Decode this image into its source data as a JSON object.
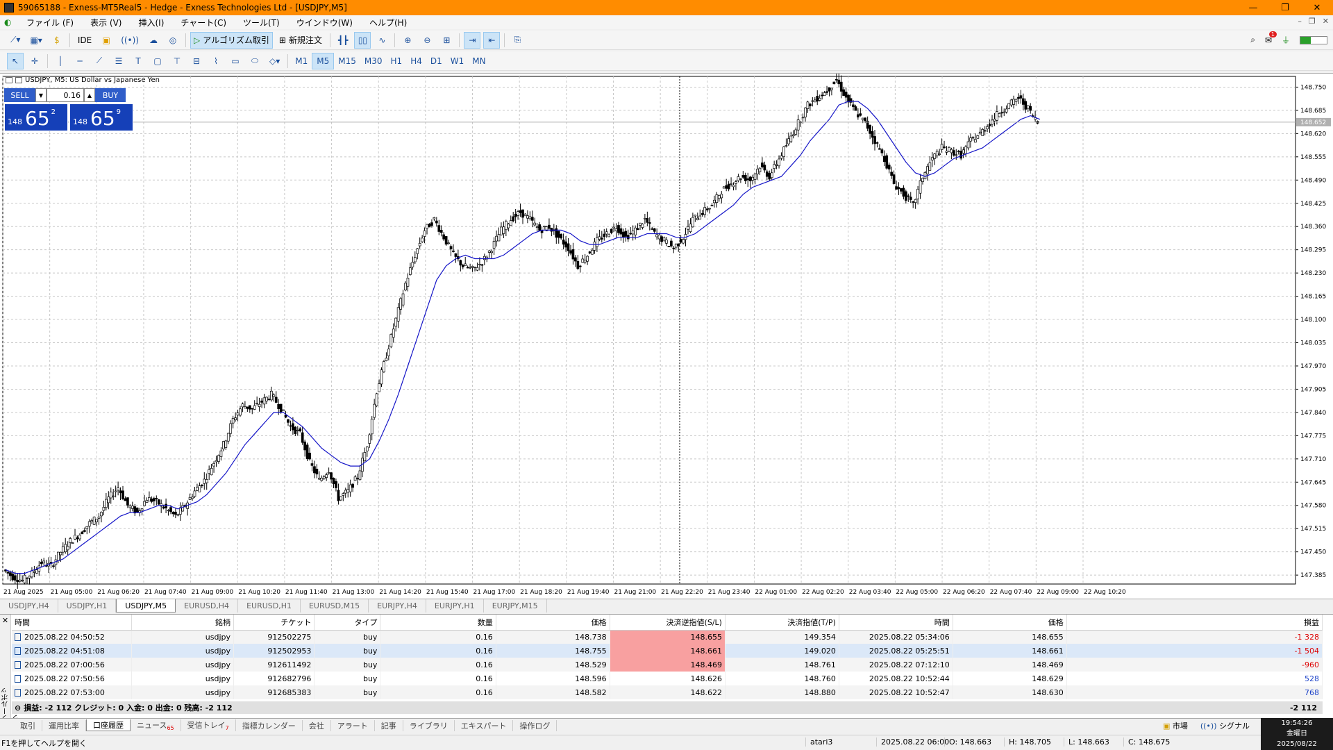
{
  "window": {
    "title": "59065188 - Exness-MT5Real5 - Hedge - Exness Technologies Ltd - [USDJPY,M5]"
  },
  "menu": [
    "ファイル (F)",
    "表示 (V)",
    "挿入(I)",
    "チャート(C)",
    "ツール(T)",
    "ウインドウ(W)",
    "ヘルプ(H)"
  ],
  "toolbar": {
    "ide": "IDE",
    "algo": "アルゴリズム取引",
    "new_order": "新規注文",
    "notif_count": "1"
  },
  "timeframes": [
    "M1",
    "M5",
    "M15",
    "M30",
    "H1",
    "H4",
    "D1",
    "W1",
    "MN"
  ],
  "active_timeframe": "M5",
  "chart": {
    "label": "USDJPY, M5:  US Dollar vs Japanese Yen",
    "sell_label": "SELL",
    "buy_label": "BUY",
    "volume": "0.16",
    "sell_prefix": "148",
    "sell_big": "65",
    "sell_sup": "2",
    "buy_prefix": "148",
    "buy_big": "65",
    "buy_sup": "9",
    "current_price": "148.652"
  },
  "chart_data": {
    "type": "candlestick",
    "symbol": "USDJPY",
    "timeframe": "M5",
    "y_ticks": [
      "148.750",
      "148.685",
      "148.620",
      "148.555",
      "148.490",
      "148.425",
      "148.360",
      "148.295",
      "148.230",
      "148.165",
      "148.100",
      "148.035",
      "147.970",
      "147.905",
      "147.840",
      "147.775",
      "147.710",
      "147.645",
      "147.580",
      "147.515",
      "147.450",
      "147.385"
    ],
    "x_ticks": [
      "21 Aug 2025",
      "21 Aug 05:00",
      "21 Aug 06:20",
      "21 Aug 07:40",
      "21 Aug 09:00",
      "21 Aug 10:20",
      "21 Aug 11:40",
      "21 Aug 13:00",
      "21 Aug 14:20",
      "21 Aug 15:40",
      "21 Aug 17:00",
      "21 Aug 18:20",
      "21 Aug 19:40",
      "21 Aug 21:00",
      "21 Aug 22:20",
      "21 Aug 23:40",
      "22 Aug 01:00",
      "22 Aug 02:20",
      "22 Aug 03:40",
      "22 Aug 05:00",
      "22 Aug 06:20",
      "22 Aug 07:40",
      "22 Aug 09:00",
      "22 Aug 10:20"
    ],
    "ylim": [
      147.36,
      148.78
    ],
    "close_path": [
      147.4,
      147.38,
      147.37,
      147.39,
      147.42,
      147.41,
      147.45,
      147.48,
      147.5,
      147.53,
      147.55,
      147.6,
      147.63,
      147.58,
      147.56,
      147.6,
      147.59,
      147.57,
      147.55,
      147.58,
      147.62,
      147.65,
      147.7,
      147.75,
      147.82,
      147.86,
      147.85,
      147.87,
      147.89,
      147.85,
      147.8,
      147.78,
      147.7,
      147.65,
      147.68,
      147.6,
      147.62,
      147.66,
      147.75,
      147.9,
      148.0,
      148.1,
      148.2,
      148.28,
      148.35,
      148.38,
      148.33,
      148.28,
      148.25,
      148.24,
      148.26,
      148.3,
      148.35,
      148.38,
      148.4,
      148.38,
      148.35,
      148.36,
      148.33,
      148.3,
      148.25,
      148.28,
      148.32,
      148.34,
      148.36,
      148.33,
      148.35,
      148.38,
      148.34,
      148.32,
      148.3,
      148.33,
      148.38,
      148.4,
      148.42,
      148.46,
      148.48,
      148.5,
      148.49,
      148.53,
      148.5,
      148.55,
      148.6,
      148.65,
      148.7,
      148.72,
      148.74,
      148.77,
      148.72,
      148.68,
      148.65,
      148.6,
      148.55,
      148.48,
      148.45,
      148.42,
      148.5,
      148.55,
      148.58,
      148.57,
      148.56,
      148.6,
      148.62,
      148.65,
      148.68,
      148.7,
      148.72,
      148.69,
      148.65
    ],
    "ma_path": [
      147.4,
      147.39,
      147.39,
      147.4,
      147.41,
      147.42,
      147.43,
      147.45,
      147.47,
      147.49,
      147.51,
      147.53,
      147.55,
      147.56,
      147.56,
      147.57,
      147.58,
      147.58,
      147.57,
      147.58,
      147.59,
      147.61,
      147.64,
      147.67,
      147.71,
      147.75,
      147.78,
      147.81,
      147.84,
      147.84,
      147.82,
      147.8,
      147.77,
      147.74,
      147.72,
      147.7,
      147.69,
      147.69,
      147.71,
      147.76,
      147.82,
      147.89,
      147.97,
      148.05,
      148.13,
      148.21,
      148.25,
      148.27,
      148.28,
      148.27,
      148.27,
      148.27,
      148.28,
      148.3,
      148.32,
      148.34,
      148.35,
      148.35,
      148.35,
      148.34,
      148.32,
      148.31,
      148.31,
      148.32,
      148.33,
      148.33,
      148.33,
      148.34,
      148.34,
      148.34,
      148.33,
      148.33,
      148.34,
      148.36,
      148.38,
      148.4,
      148.42,
      148.45,
      148.47,
      148.48,
      148.49,
      148.5,
      148.53,
      148.56,
      148.6,
      148.63,
      148.66,
      148.7,
      148.71,
      148.71,
      148.69,
      148.66,
      148.62,
      148.58,
      148.54,
      148.51,
      148.5,
      148.51,
      148.53,
      148.55,
      148.56,
      148.57,
      148.58,
      148.6,
      148.62,
      148.64,
      148.66,
      148.67,
      148.66
    ]
  },
  "chart_tabs": [
    "USDJPY,H4",
    "USDJPY,H1",
    "USDJPY,M5",
    "EURUSD,H4",
    "EURUSD,H1",
    "EURUSD,M15",
    "EURJPY,H4",
    "EURJPY,H1",
    "EURJPY,M15"
  ],
  "active_chart_tab": "USDJPY,M5",
  "history": {
    "columns": [
      "時間",
      "銘柄",
      "チケット",
      "タイプ",
      "数量",
      "価格",
      "決済逆指値(S/L)",
      "決済指値(T/P)",
      "時間",
      "価格",
      "損益"
    ],
    "rows": [
      [
        "2025.08.22 04:50:52",
        "usdjpy",
        "912502275",
        "buy",
        "0.16",
        "148.738",
        "148.655",
        "149.354",
        "2025.08.22 05:34:06",
        "148.655",
        "-1 328"
      ],
      [
        "2025.08.22 04:51:08",
        "usdjpy",
        "912502953",
        "buy",
        "0.16",
        "148.755",
        "148.661",
        "149.020",
        "2025.08.22 05:25:51",
        "148.661",
        "-1 504"
      ],
      [
        "2025.08.22 07:00:56",
        "usdjpy",
        "912611492",
        "buy",
        "0.16",
        "148.529",
        "148.469",
        "148.761",
        "2025.08.22 07:12:10",
        "148.469",
        "-960"
      ],
      [
        "2025.08.22 07:50:56",
        "usdjpy",
        "912682796",
        "buy",
        "0.16",
        "148.596",
        "148.626",
        "148.760",
        "2025.08.22 10:52:44",
        "148.629",
        "528"
      ],
      [
        "2025.08.22 07:53:00",
        "usdjpy",
        "912685383",
        "buy",
        "0.16",
        "148.582",
        "148.622",
        "148.880",
        "2025.08.22 10:52:47",
        "148.630",
        "768"
      ]
    ],
    "summary": "損益: -2 112  クレジット: 0  入金: 0  出金: 0  残高: -2 112",
    "summary_total": "-2 112"
  },
  "toolbox_label": "ツールボックス",
  "bottom_tabs": [
    "取引",
    "運用比率",
    "口座履歴",
    "ニュース",
    "受信トレイ",
    "指標カレンダー",
    "会社",
    "アラート",
    "記事",
    "ライブラリ",
    "エキスパート",
    "操作ログ"
  ],
  "bottom_tab_counts": {
    "news": "65",
    "inbox": "7"
  },
  "active_bottom_tab": "口座履歴",
  "bottom_right": {
    "market": "市場",
    "signal": "シグナル"
  },
  "clock": {
    "time": "19:54:26",
    "day": "金曜日",
    "date": "2025/08/22"
  },
  "status": {
    "help": "F1を押してヘルプを開く",
    "profile": "atari3",
    "bar_time": "2025.08.22 06:00",
    "open": "O: 148.663",
    "high": "H: 148.705",
    "low": "L: 148.663",
    "close": "C: 148.675"
  }
}
